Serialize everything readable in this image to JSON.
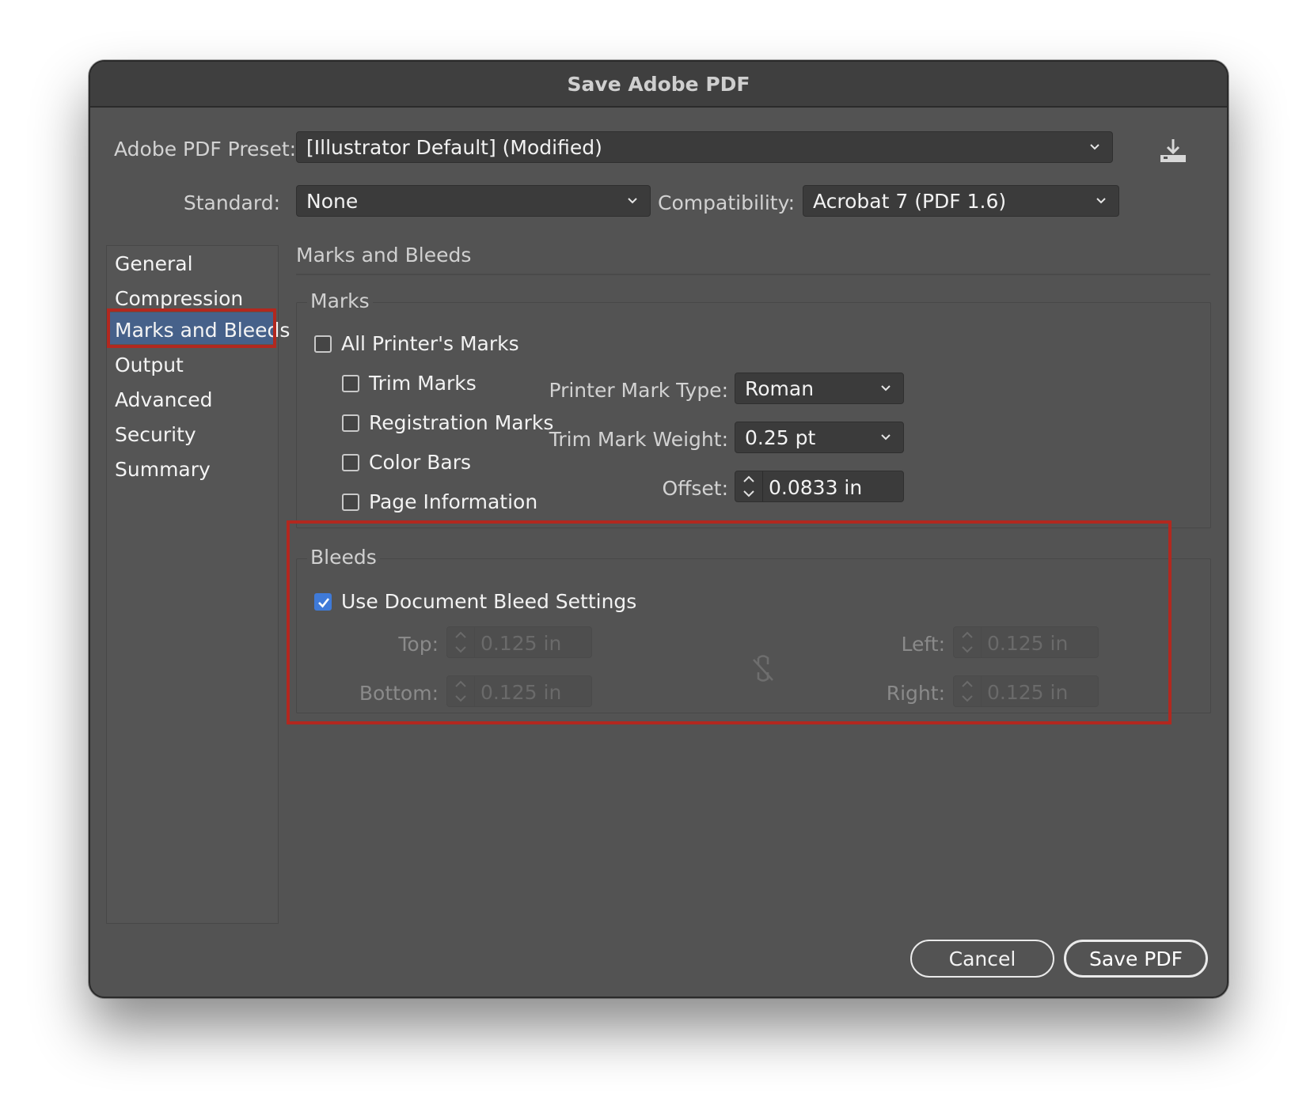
{
  "window": {
    "title": "Save Adobe PDF"
  },
  "preset": {
    "label": "Adobe PDF Preset:",
    "value": "[Illustrator Default] (Modified)",
    "save_icon": "download-icon"
  },
  "standard": {
    "label": "Standard:",
    "value": "None"
  },
  "compatibility": {
    "label": "Compatibility:",
    "value": "Acrobat 7 (PDF 1.6)"
  },
  "sidebar": {
    "items": [
      {
        "label": "General"
      },
      {
        "label": "Compression"
      },
      {
        "label": "Marks and Bleeds",
        "selected": true
      },
      {
        "label": "Output"
      },
      {
        "label": "Advanced"
      },
      {
        "label": "Security"
      },
      {
        "label": "Summary"
      }
    ]
  },
  "section": {
    "title": "Marks and Bleeds"
  },
  "marks": {
    "title": "Marks",
    "all_printers_marks": {
      "label": "All Printer's Marks",
      "checked": false
    },
    "trim_marks": {
      "label": "Trim Marks",
      "checked": false
    },
    "registration_marks": {
      "label": "Registration Marks",
      "checked": false
    },
    "color_bars": {
      "label": "Color Bars",
      "checked": false
    },
    "page_information": {
      "label": "Page Information",
      "checked": false
    },
    "printer_mark_type": {
      "label": "Printer Mark Type:",
      "value": "Roman"
    },
    "trim_mark_weight": {
      "label": "Trim Mark Weight:",
      "value": "0.25 pt"
    },
    "offset": {
      "label": "Offset:",
      "value": "0.0833 in"
    }
  },
  "bleeds": {
    "title": "Bleeds",
    "use_document_bleed": {
      "label": "Use Document Bleed Settings",
      "checked": true
    },
    "top": {
      "label": "Top:",
      "value": "0.125 in"
    },
    "bottom": {
      "label": "Bottom:",
      "value": "0.125 in"
    },
    "left": {
      "label": "Left:",
      "value": "0.125 in"
    },
    "right": {
      "label": "Right:",
      "value": "0.125 in"
    },
    "link_icon": "broken-link-icon"
  },
  "buttons": {
    "cancel": "Cancel",
    "save": "Save PDF"
  },
  "colors": {
    "highlight": "#b2281f",
    "selection": "#46618a",
    "checkbox": "#3f7ad8"
  }
}
